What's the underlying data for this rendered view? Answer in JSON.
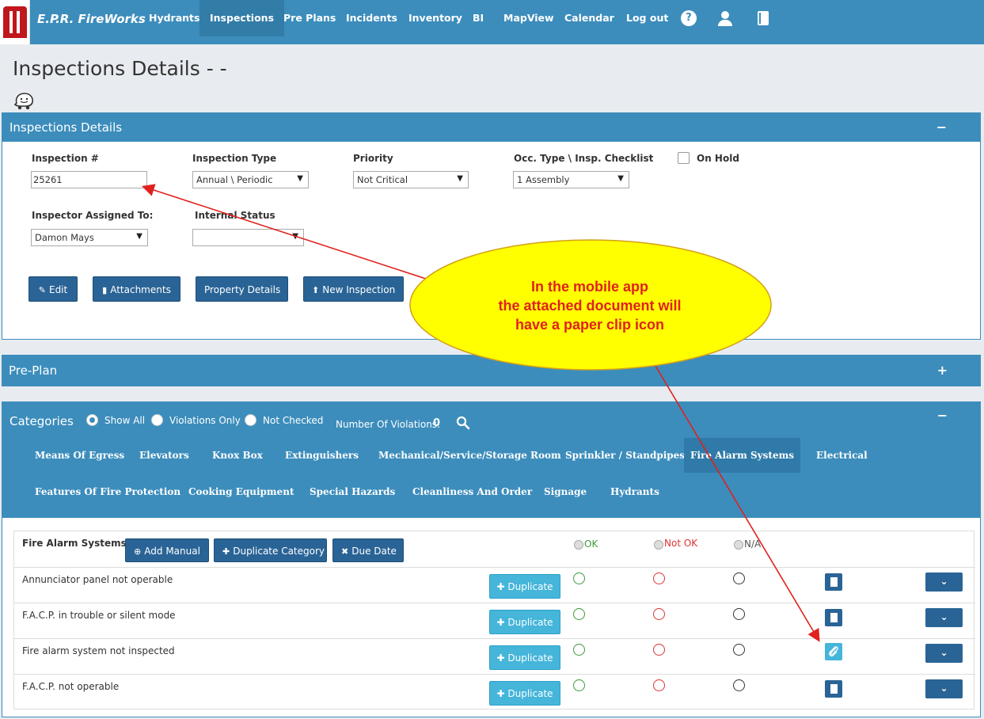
{
  "nav": {
    "brand": "E.P.R. FireWorks",
    "items": [
      "Hydrants",
      "Inspections",
      "Pre Plans",
      "Incidents",
      "Inventory",
      "BI",
      "MapView",
      "Calendar",
      "Log out"
    ],
    "active": "Inspections",
    "icons": [
      "help-icon",
      "user-icon",
      "book-icon"
    ]
  },
  "page": {
    "title": "Inspections Details - -"
  },
  "details": {
    "header": "Inspections Details",
    "toggle": "−",
    "inspection_no_label": "Inspection #",
    "inspection_no_value": "25261",
    "type_label": "Inspection Type",
    "type_value": "Annual \\ Periodic",
    "priority_label": "Priority",
    "priority_value": "Not Critical",
    "occ_label": "Occ. Type \\ Insp. Checklist",
    "occ_value": "1 Assembly",
    "onhold_label": "On Hold",
    "inspector_label": "Inspector Assigned To:",
    "inspector_value": "Damon Mays",
    "status_label": "Internal Status",
    "status_value": "",
    "buttons": {
      "edit": "Edit",
      "attachments": "Attachments",
      "property": "Property Details",
      "new": "New Inspection"
    }
  },
  "preplan": {
    "header": "Pre-Plan",
    "toggle": "+"
  },
  "categories": {
    "header": "Categories",
    "toggle": "−",
    "options": [
      "Show All",
      "Violations Only",
      "Not Checked"
    ],
    "selected": "Show All",
    "violations_label": "Number Of Violations:",
    "violations_count": "0",
    "tabs_row1": [
      "Means Of Egress",
      "Elevators",
      "Knox Box",
      "Extinguishers",
      "Mechanical/Service/Storage Room",
      "Sprinkler / Standpipes",
      "Fire Alarm Systems",
      "Electrical"
    ],
    "tabs_row2": [
      "Features Of Fire Protection",
      "Cooking Equipment",
      "Special Hazards",
      "Cleanliness And Order",
      "Signage",
      "Hydrants"
    ],
    "active_tab": "Fire Alarm Systems"
  },
  "list": {
    "section_title": "Fire Alarm Systems",
    "add_manual": "Add Manual",
    "duplicate_category": "Duplicate Category",
    "due_date": "Due Date",
    "col_ok": "OK",
    "col_not_ok": "Not OK",
    "col_na": "N/A",
    "duplicate_label": "Duplicate",
    "rows": [
      {
        "text": "Annunciator panel not operable",
        "attachment": false
      },
      {
        "text": "F.A.C.P. in trouble or silent mode",
        "attachment": false
      },
      {
        "text": "Fire alarm system not inspected",
        "attachment": true
      },
      {
        "text": "F.A.C.P. not operable",
        "attachment": false
      }
    ]
  },
  "annotation": {
    "lines": [
      "In the mobile app",
      "the attached document will",
      "have a paper clip icon"
    ],
    "fill": "#ffff00",
    "text_color": "#e0211d"
  },
  "colors": {
    "primary": "#3c8dbc",
    "dark_button": "#2a6496",
    "light_button": "#45b5da"
  }
}
